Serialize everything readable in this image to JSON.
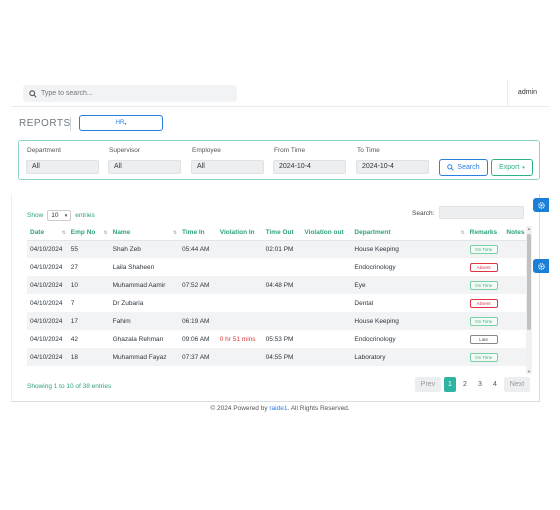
{
  "topbar": {
    "search_placeholder": "Type to search...",
    "user": "admin"
  },
  "header": {
    "title": "REPORTS",
    "dropdown_label": "HR"
  },
  "filters": {
    "department": {
      "label": "Department",
      "value": "All"
    },
    "supervisor": {
      "label": "Supervisor",
      "value": "All"
    },
    "employee": {
      "label": "Employee",
      "value": "All"
    },
    "from_time": {
      "label": "From Time",
      "value": "2024-10-4"
    },
    "to_time": {
      "label": "To Time",
      "value": "2024-10-4"
    },
    "search_button": "Search",
    "export_button": "Export"
  },
  "table": {
    "show_label": "Show",
    "entries_label": "entries",
    "page_length": "10",
    "search_label": "Search:",
    "columns": [
      "Date",
      "Emp No",
      "Name",
      "Time In",
      "Violation In",
      "Time Out",
      "Violation out",
      "Department",
      "Remarks",
      "Notes"
    ],
    "rows": [
      {
        "date": "04/10/2024",
        "emp_no": "55",
        "name": "Shah Zeb",
        "time_in": "05:44 AM",
        "violation_in": "",
        "time_out": "02:01 PM",
        "violation_out": "",
        "department": "House Keeping",
        "remarks": "On Time",
        "remark_type": "ontime",
        "notes": ""
      },
      {
        "date": "04/10/2024",
        "emp_no": "27",
        "name": "Laila Shaheen",
        "time_in": "",
        "violation_in": "",
        "time_out": "",
        "violation_out": "",
        "department": "Endocrinology",
        "remarks": "Absent",
        "remark_type": "absent",
        "notes": ""
      },
      {
        "date": "04/10/2024",
        "emp_no": "10",
        "name": "Muhammad Aamir",
        "time_in": "07:52 AM",
        "violation_in": "",
        "time_out": "04:48 PM",
        "violation_out": "",
        "department": "Eye",
        "remarks": "On Time",
        "remark_type": "ontime",
        "notes": ""
      },
      {
        "date": "04/10/2024",
        "emp_no": "7",
        "name": "Dr Zubaria",
        "time_in": "",
        "violation_in": "",
        "time_out": "",
        "violation_out": "",
        "department": "Dental",
        "remarks": "Absent",
        "remark_type": "absent",
        "notes": ""
      },
      {
        "date": "04/10/2024",
        "emp_no": "17",
        "name": "Fahim",
        "time_in": "06:19 AM",
        "violation_in": "",
        "time_out": "",
        "violation_out": "",
        "department": "House Keeping",
        "remarks": "On Time",
        "remark_type": "ontime",
        "notes": ""
      },
      {
        "date": "04/10/2024",
        "emp_no": "42",
        "name": "Ghazala Rehman",
        "time_in": "09:06 AM",
        "violation_in": "0 hr 51 mins",
        "time_out": "05:53 PM",
        "violation_out": "",
        "department": "Endocrinology",
        "remarks": "Late",
        "remark_type": "late",
        "notes": ""
      },
      {
        "date": "04/10/2024",
        "emp_no": "18",
        "name": "Muhammad Fayaz",
        "time_in": "07:37 AM",
        "violation_in": "",
        "time_out": "04:55 PM",
        "violation_out": "",
        "department": "Laboratory",
        "remarks": "On Time",
        "remark_type": "ontime",
        "notes": ""
      }
    ],
    "info": "Showing 1 to 10 of 38 entries",
    "pagination": {
      "prev": "Prev",
      "pages": [
        "1",
        "2",
        "3",
        "4"
      ],
      "active_page": "1",
      "next": "Next"
    }
  },
  "footer": {
    "text": "© 2024 Powered by",
    "brand": "raide1",
    "suffix": ". All Rights Reserved."
  },
  "colors": {
    "accent_green": "#2fa37a",
    "primary_blue": "#2a7de1",
    "pagination_active": "#2fb3a3"
  }
}
